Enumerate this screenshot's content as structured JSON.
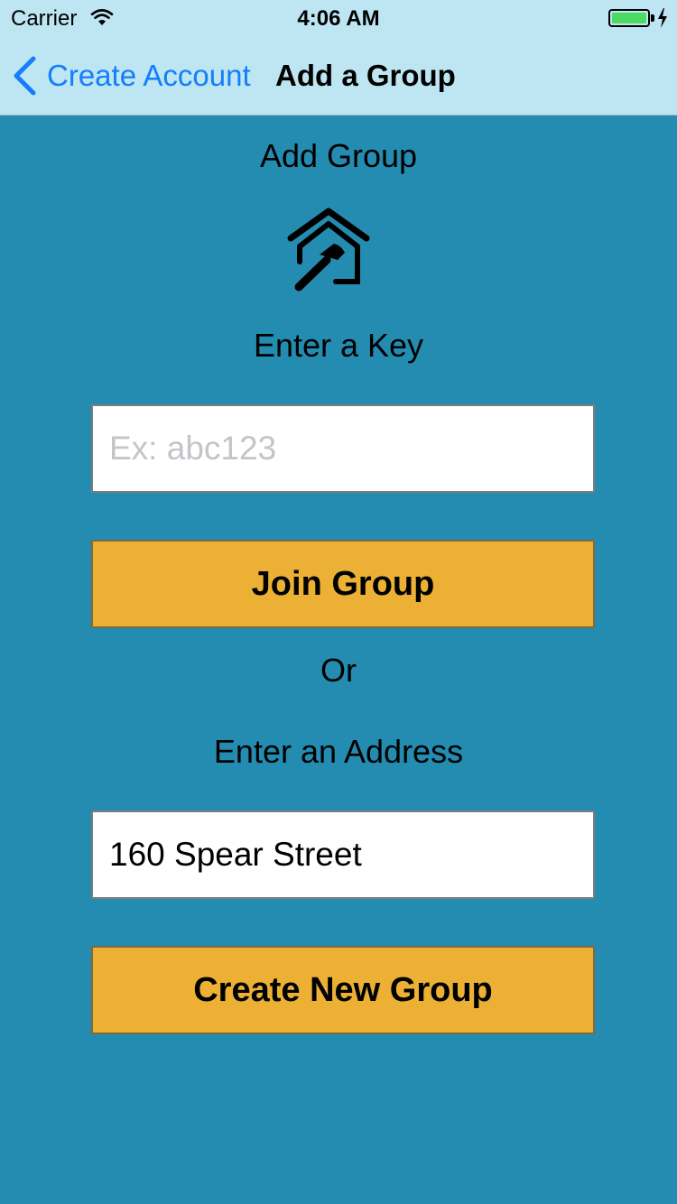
{
  "status_bar": {
    "carrier": "Carrier",
    "time": "4:06 AM",
    "battery_color": "#4cd964"
  },
  "nav": {
    "back_label": "Create Account",
    "title": "Add a Group",
    "back_icon": "chevron-left-icon"
  },
  "content": {
    "heading": "Add Group",
    "icon": "house-hammer-icon",
    "key_label": "Enter a Key",
    "key_placeholder": "Ex: abc123",
    "key_value": "",
    "join_button": "Join Group",
    "or_text": "Or",
    "address_label": "Enter an Address",
    "address_value": "160 Spear Street",
    "create_button": "Create New Group"
  },
  "colors": {
    "background": "#238cb0",
    "nav_background": "#bde5f2",
    "accent_link": "#147efb",
    "button": "#ebb034"
  }
}
